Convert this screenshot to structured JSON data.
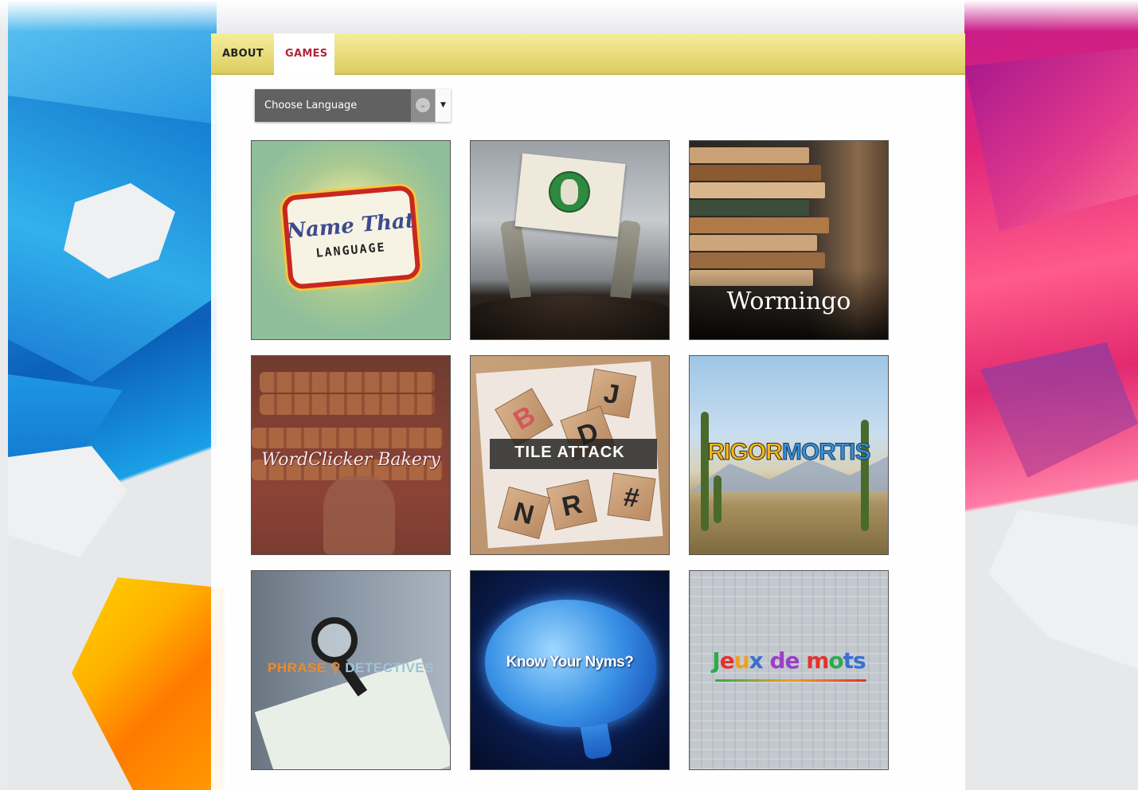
{
  "nav": {
    "tabs": [
      {
        "label": "ABOUT",
        "active": false
      },
      {
        "label": "GAMES",
        "active": true
      }
    ]
  },
  "language_select": {
    "selected": "Choose Language"
  },
  "games": [
    {
      "name": "name-that-language",
      "title_line1": "Name That",
      "title_line2": "LANGUAGE"
    },
    {
      "name": "zombie-game",
      "title_line1": "",
      "title_line2": ""
    },
    {
      "name": "wormingo",
      "title_line1": "Wormingo"
    },
    {
      "name": "wordclicker-bakery",
      "title_line1": "WordClicker Bakery"
    },
    {
      "name": "tile-attack",
      "title_line1": "TILE ATTACK",
      "letters": [
        "J",
        "B",
        "R",
        "N",
        "#",
        "D"
      ]
    },
    {
      "name": "rigor-mortis",
      "title_part1": "RIGOR",
      "title_part2": "MORTIS"
    },
    {
      "name": "phrase-detectives",
      "title_part1": "PHRASE",
      "title_part2": "DETECTIVES"
    },
    {
      "name": "know-your-nyms",
      "title_line1": "Know Your Nyms?"
    },
    {
      "name": "jeux-de-mots",
      "title_letters": [
        "J",
        "e",
        "u",
        "x"
      ],
      "title_word2": "de",
      "title_word3_letters": [
        "m",
        "o",
        "ts"
      ]
    }
  ],
  "colors": {
    "tab_bar": "#e8dc7c",
    "active_tab_text": "#b3243b",
    "select_bg": "#616161"
  }
}
